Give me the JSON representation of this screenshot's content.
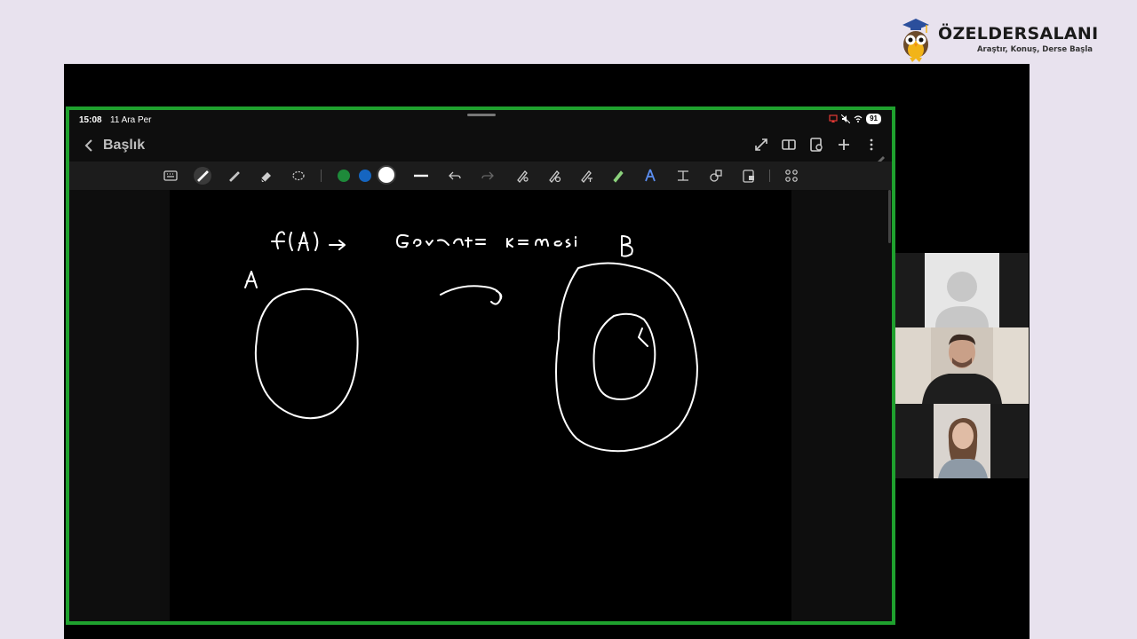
{
  "brand": {
    "name": "ÖZELDERSALANI",
    "tagline": "Araştır, Konuş, Derse Başla"
  },
  "tablet": {
    "status": {
      "time": "15:08",
      "date": "11 Ara Per",
      "battery": "91"
    },
    "document_title": "Başlık",
    "colors": {
      "border": "#1fa12e",
      "ink": "#ffffff",
      "swatch_green": "#1e8a3a",
      "swatch_blue": "#1565c0",
      "swatch_white": "#ffffff"
    },
    "toolbar_icons": [
      "keyboard-icon",
      "pen-icon",
      "highlighter-icon",
      "eraser-icon",
      "lasso-icon",
      "green-color",
      "blue-color",
      "white-color",
      "stroke-width-icon",
      "undo-icon",
      "redo-icon",
      "pen-settings-icon",
      "shape-icon",
      "text-icon",
      "magic-pen-icon",
      "ai-icon",
      "insert-text-icon",
      "shapes-icon",
      "image-icon",
      "more-tools-icon"
    ]
  },
  "participants": [
    {
      "name": "placeholder-avatar"
    },
    {
      "name": "male-participant"
    },
    {
      "name": "female-participant"
    }
  ]
}
